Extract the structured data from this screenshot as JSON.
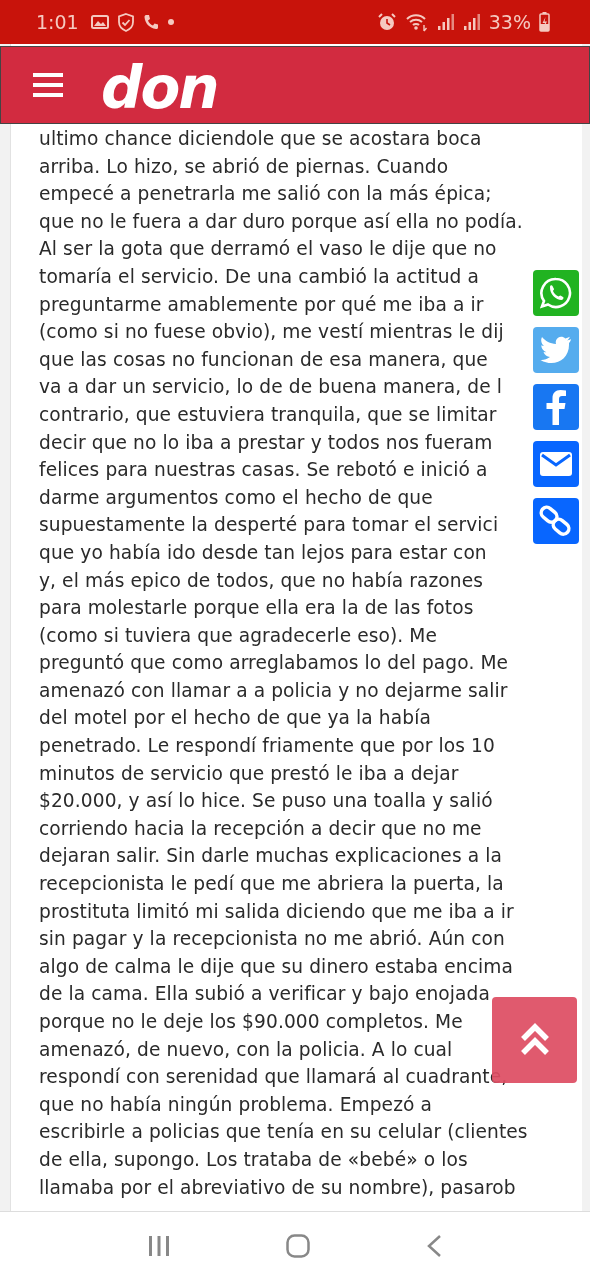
{
  "status_bar": {
    "time": "1:01",
    "battery": "33%"
  },
  "header": {
    "logo_text": "don"
  },
  "article": {
    "lines": [
      "ultimo chance diciendole que se acostara boca",
      "arriba. Lo hizo, se abrió de piernas. Cuando",
      "empecé a penetrarla me salió con la más épica;",
      "que no le fuera a dar duro porque así ella no podía.",
      "Al ser la gota que derramó el vaso le dije que no",
      "tomaría el servicio. De una cambió la actitud a",
      "preguntarme amablemente por qué me iba a ir",
      "(como si no fuese obvio), me vestí mientras le dij",
      "que las cosas no funcionan de esa manera, que",
      "va a dar un servicio, lo de de buena manera, de l",
      "contrario, que estuviera tranquila, que se limitar",
      "decir que no lo iba a prestar y todos nos fueram",
      "felices para nuestras casas. Se rebotó e inició a",
      "darme argumentos como el hecho de que",
      "supuestamente la desperté para tomar el servici",
      "que yo había ido desde tan lejos para estar con",
      "y, el más epico de todos, que no había razones",
      "para molestarle porque ella era la de las fotos",
      "(como si tuviera que agradecerle eso). Me",
      "preguntó que como arreglabamos lo del pago. Me",
      "amenazó con llamar a a policia y no dejarme salir",
      "del motel por el hecho de que ya la había",
      "penetrado. Le respondí friamente que por los 10",
      "minutos de servicio que prestó le iba a dejar",
      "$20.000, y así lo hice. Se puso una toalla y salió",
      "corriendo hacia la recepción a decir que no me",
      "dejaran salir. Sin darle muchas explicaciones a la",
      "recepcionista le pedí que me abriera la puerta, la",
      "prostituta limitó mi salida diciendo que me iba a ir",
      "sin pagar y la recepcionista no me abrió. Aún con",
      "algo de calma le dije que su dinero estaba encima",
      "de la cama. Ella subió a verificar y bajo enojada",
      "porque no le deje los $90.000 completos. Me",
      "amenazó, de nuevo, con la policia. A lo cual",
      "respondí con serenidad que llamará al cuadrante,",
      "que no había ningún problema. Empezó a",
      "escribirle a policias que tenía en su celular (clientes",
      "de ella, supongo. Los trataba de «bebé» o los",
      "llamaba por el abreviativo de su nombre), pasarob"
    ]
  },
  "share_buttons": [
    {
      "kind": "whatsapp"
    },
    {
      "kind": "twitter"
    },
    {
      "kind": "facebook"
    },
    {
      "kind": "email"
    },
    {
      "kind": "link"
    }
  ]
}
